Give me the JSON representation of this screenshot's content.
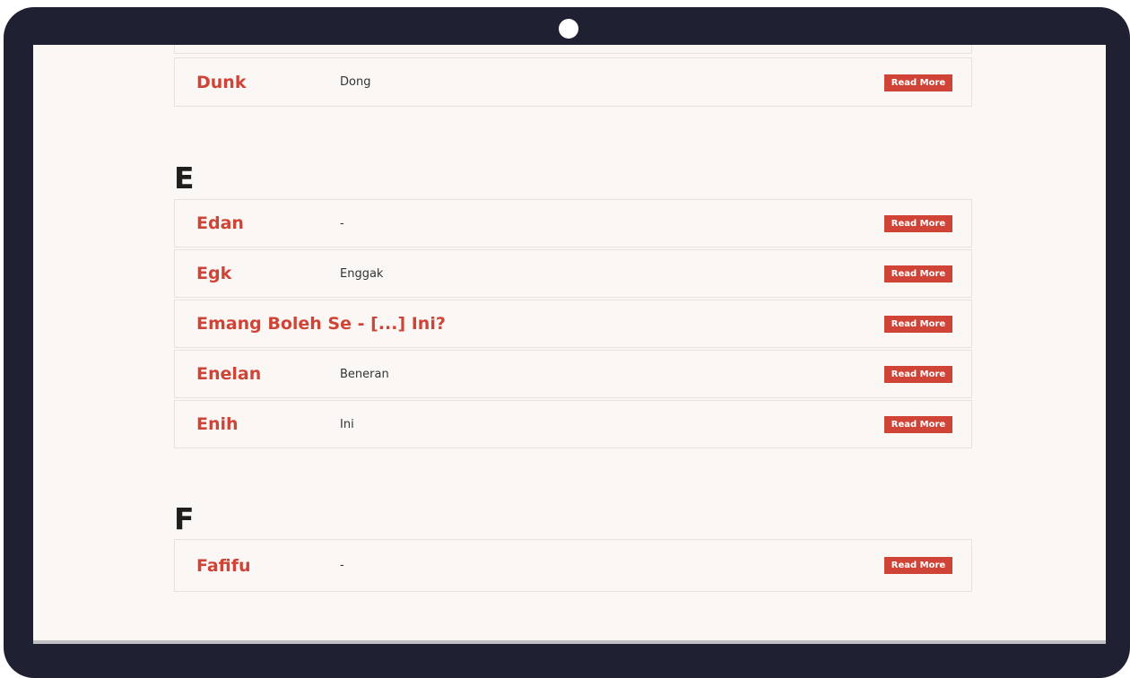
{
  "sections": [
    {
      "letter": "",
      "entries": [
        {
          "word": "",
          "meaning": "",
          "button": ""
        },
        {
          "word": "Dunk",
          "meaning": "Dong",
          "button": "Read More"
        }
      ]
    },
    {
      "letter": "E",
      "entries": [
        {
          "word": "Edan",
          "meaning": "-",
          "button": "Read More"
        },
        {
          "word": "Egk",
          "meaning": "Enggak",
          "button": "Read More"
        },
        {
          "word": "Emang Boleh Se - [...] Ini?",
          "meaning": "",
          "button": "Read More"
        },
        {
          "word": "Enelan",
          "meaning": "Beneran",
          "button": "Read More"
        },
        {
          "word": "Enih",
          "meaning": "Ini",
          "button": "Read More"
        }
      ]
    },
    {
      "letter": "F",
      "entries": [
        {
          "word": "Fafifu",
          "meaning": "-",
          "button": "Read More"
        }
      ]
    }
  ],
  "colors": {
    "accent": "#cf4436",
    "bezel": "#1f2133",
    "page_background": "#fbf7f5"
  }
}
